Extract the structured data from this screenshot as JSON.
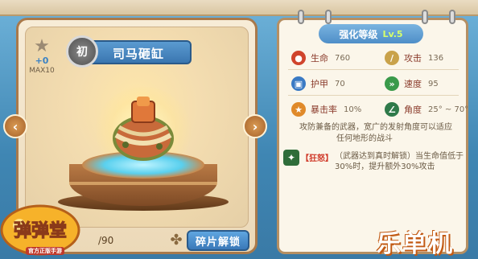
{
  "item": {
    "rank_badge": "初",
    "name": "司马砸缸",
    "star_bonus": "+0",
    "star_max": "MAX10",
    "shard_progress": "/90",
    "unlock_button": "碎片解锁"
  },
  "stats_panel": {
    "title": "强化等级",
    "level": "Lv.5",
    "stats": [
      {
        "icon": "blood-drop-icon",
        "label": "生命",
        "value": "760",
        "color": "#d0442c"
      },
      {
        "icon": "sword-icon",
        "label": "攻击",
        "value": "136",
        "color": "#c9a24a"
      },
      {
        "icon": "armor-icon",
        "label": "护甲",
        "value": "70",
        "color": "#3a7ac4"
      },
      {
        "icon": "speed-icon",
        "label": "速度",
        "value": "95",
        "color": "#3a9a4a"
      },
      {
        "icon": "crit-star-icon",
        "label": "暴击率",
        "value": "10%",
        "color": "#e08a2a"
      },
      {
        "icon": "angle-icon",
        "label": "角度",
        "value": "25° ~ 70°",
        "color": "#2f7a4a"
      }
    ],
    "description": [
      "攻防兼备的武器，宽广的发射角度可以适应",
      "任何地形的战斗"
    ],
    "skill": {
      "tag": "【狂怒】",
      "text": [
        "（武器达到真时解锁）当生命值低于",
        "30%时，提升额外30%攻击"
      ]
    }
  },
  "branding": {
    "game_logo": "弹弹堂",
    "game_logo_sub": "官方正版手游",
    "site_logo": "乐单机"
  },
  "colors": {
    "accent_blue": "#3a78b8",
    "panel_bg": "#fbf6ea",
    "frame_brown": "#a9794a"
  }
}
